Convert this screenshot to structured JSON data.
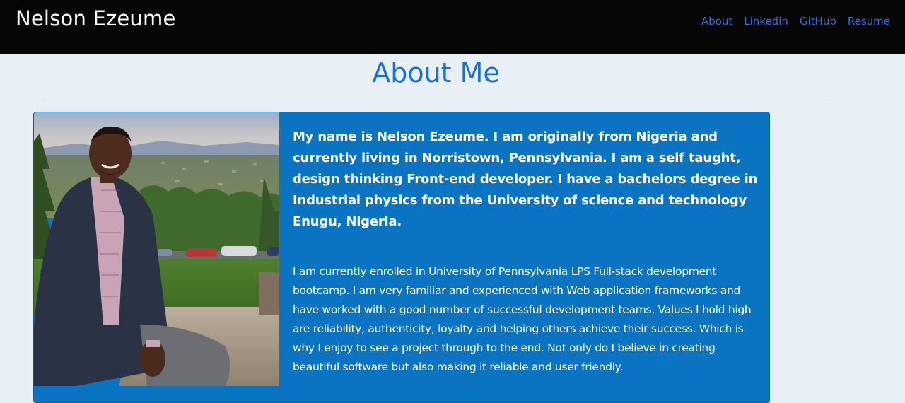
{
  "header": {
    "brand": "Nelson Ezeume",
    "nav": [
      "About",
      "Linkedin",
      "GitHub",
      "Resume"
    ]
  },
  "main": {
    "title": "About Me",
    "intro": "My name is Nelson Ezeume. I am originally from Nigeria and currently living in Norristown, Pennsylvania. I am a self taught, design thinking Front-end developer. I have a bachelors degree in Industrial physics from the University of science and technology Enugu, Nigeria.",
    "bio": "I am currently enrolled in University of Pennsylvania LPS Full-stack development bootcamp. I am very familiar and experienced with Web application frameworks and have worked with a good number of successful development teams. Values I hold high are reliability, authenticity, loyalty and helping others achieve their success. Which is why I enjoy to see a project through to the end. Not only do I believe in creating beautiful software but also making it reliable and user friendly."
  },
  "colors": {
    "navbar": "#060606",
    "accent": "#1a6fd6",
    "card": "#0a74c2",
    "background": "#e8f0f5"
  }
}
